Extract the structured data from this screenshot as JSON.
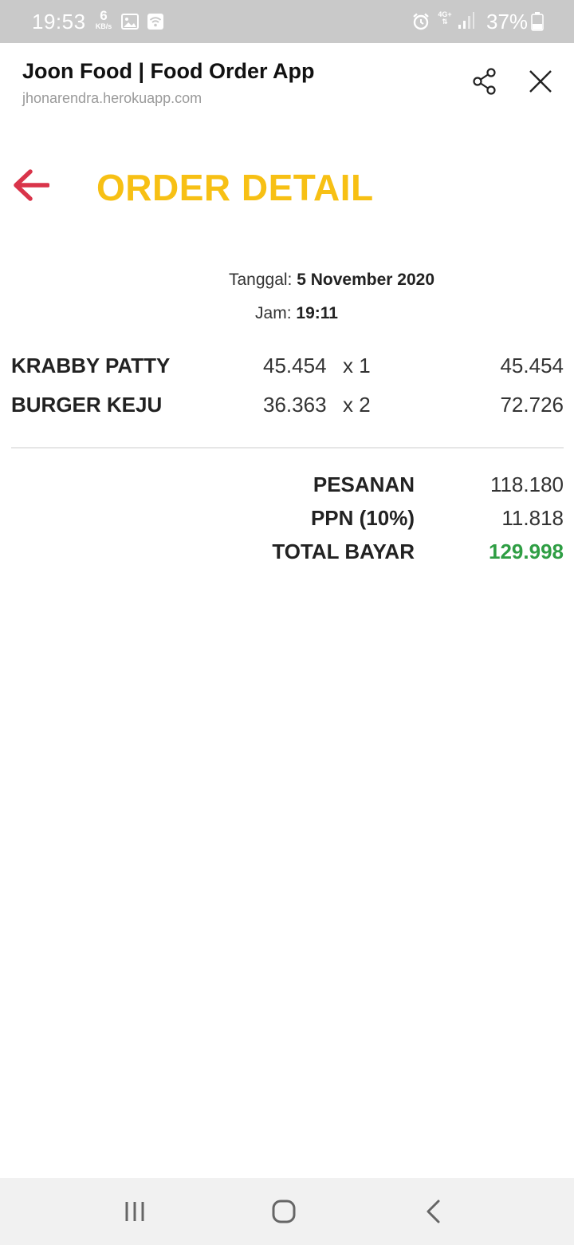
{
  "status_bar": {
    "time": "19:53",
    "net_speed_value": "6",
    "net_speed_unit": "KB/s",
    "network_type": "4G+",
    "battery_percent": "37%",
    "icons": [
      "gallery-icon",
      "wifi-hotspot-icon",
      "alarm-icon",
      "signal-icon",
      "battery-icon"
    ]
  },
  "browser": {
    "title": "Joon Food | Food Order App",
    "url": "jhonarendra.herokuapp.com",
    "icons": [
      "share-icon",
      "close-icon"
    ]
  },
  "page": {
    "title": "ORDER DETAIL",
    "back_icon": "arrow-left-icon",
    "accent_color": "#f7c014",
    "back_color": "#d9344a",
    "date_label": "Tanggal:",
    "date_value": "5 November 2020",
    "time_label": "Jam:",
    "time_value": "19:11"
  },
  "items": [
    {
      "name": "KRABBY PATTY",
      "price": "45.454",
      "qty": "x 1",
      "subtotal": "45.454"
    },
    {
      "name": "BURGER KEJU",
      "price": "36.363",
      "qty": "x 2",
      "subtotal": "72.726"
    }
  ],
  "summary": {
    "order_label": "PESANAN",
    "order_value": "118.180",
    "tax_label": "PPN (10%)",
    "tax_value": "11.818",
    "total_label": "TOTAL BAYAR",
    "total_value": "129.998",
    "total_color": "#2f9e44"
  },
  "nav_bar": {
    "icons": [
      "recent-apps-icon",
      "home-icon",
      "back-icon"
    ]
  }
}
